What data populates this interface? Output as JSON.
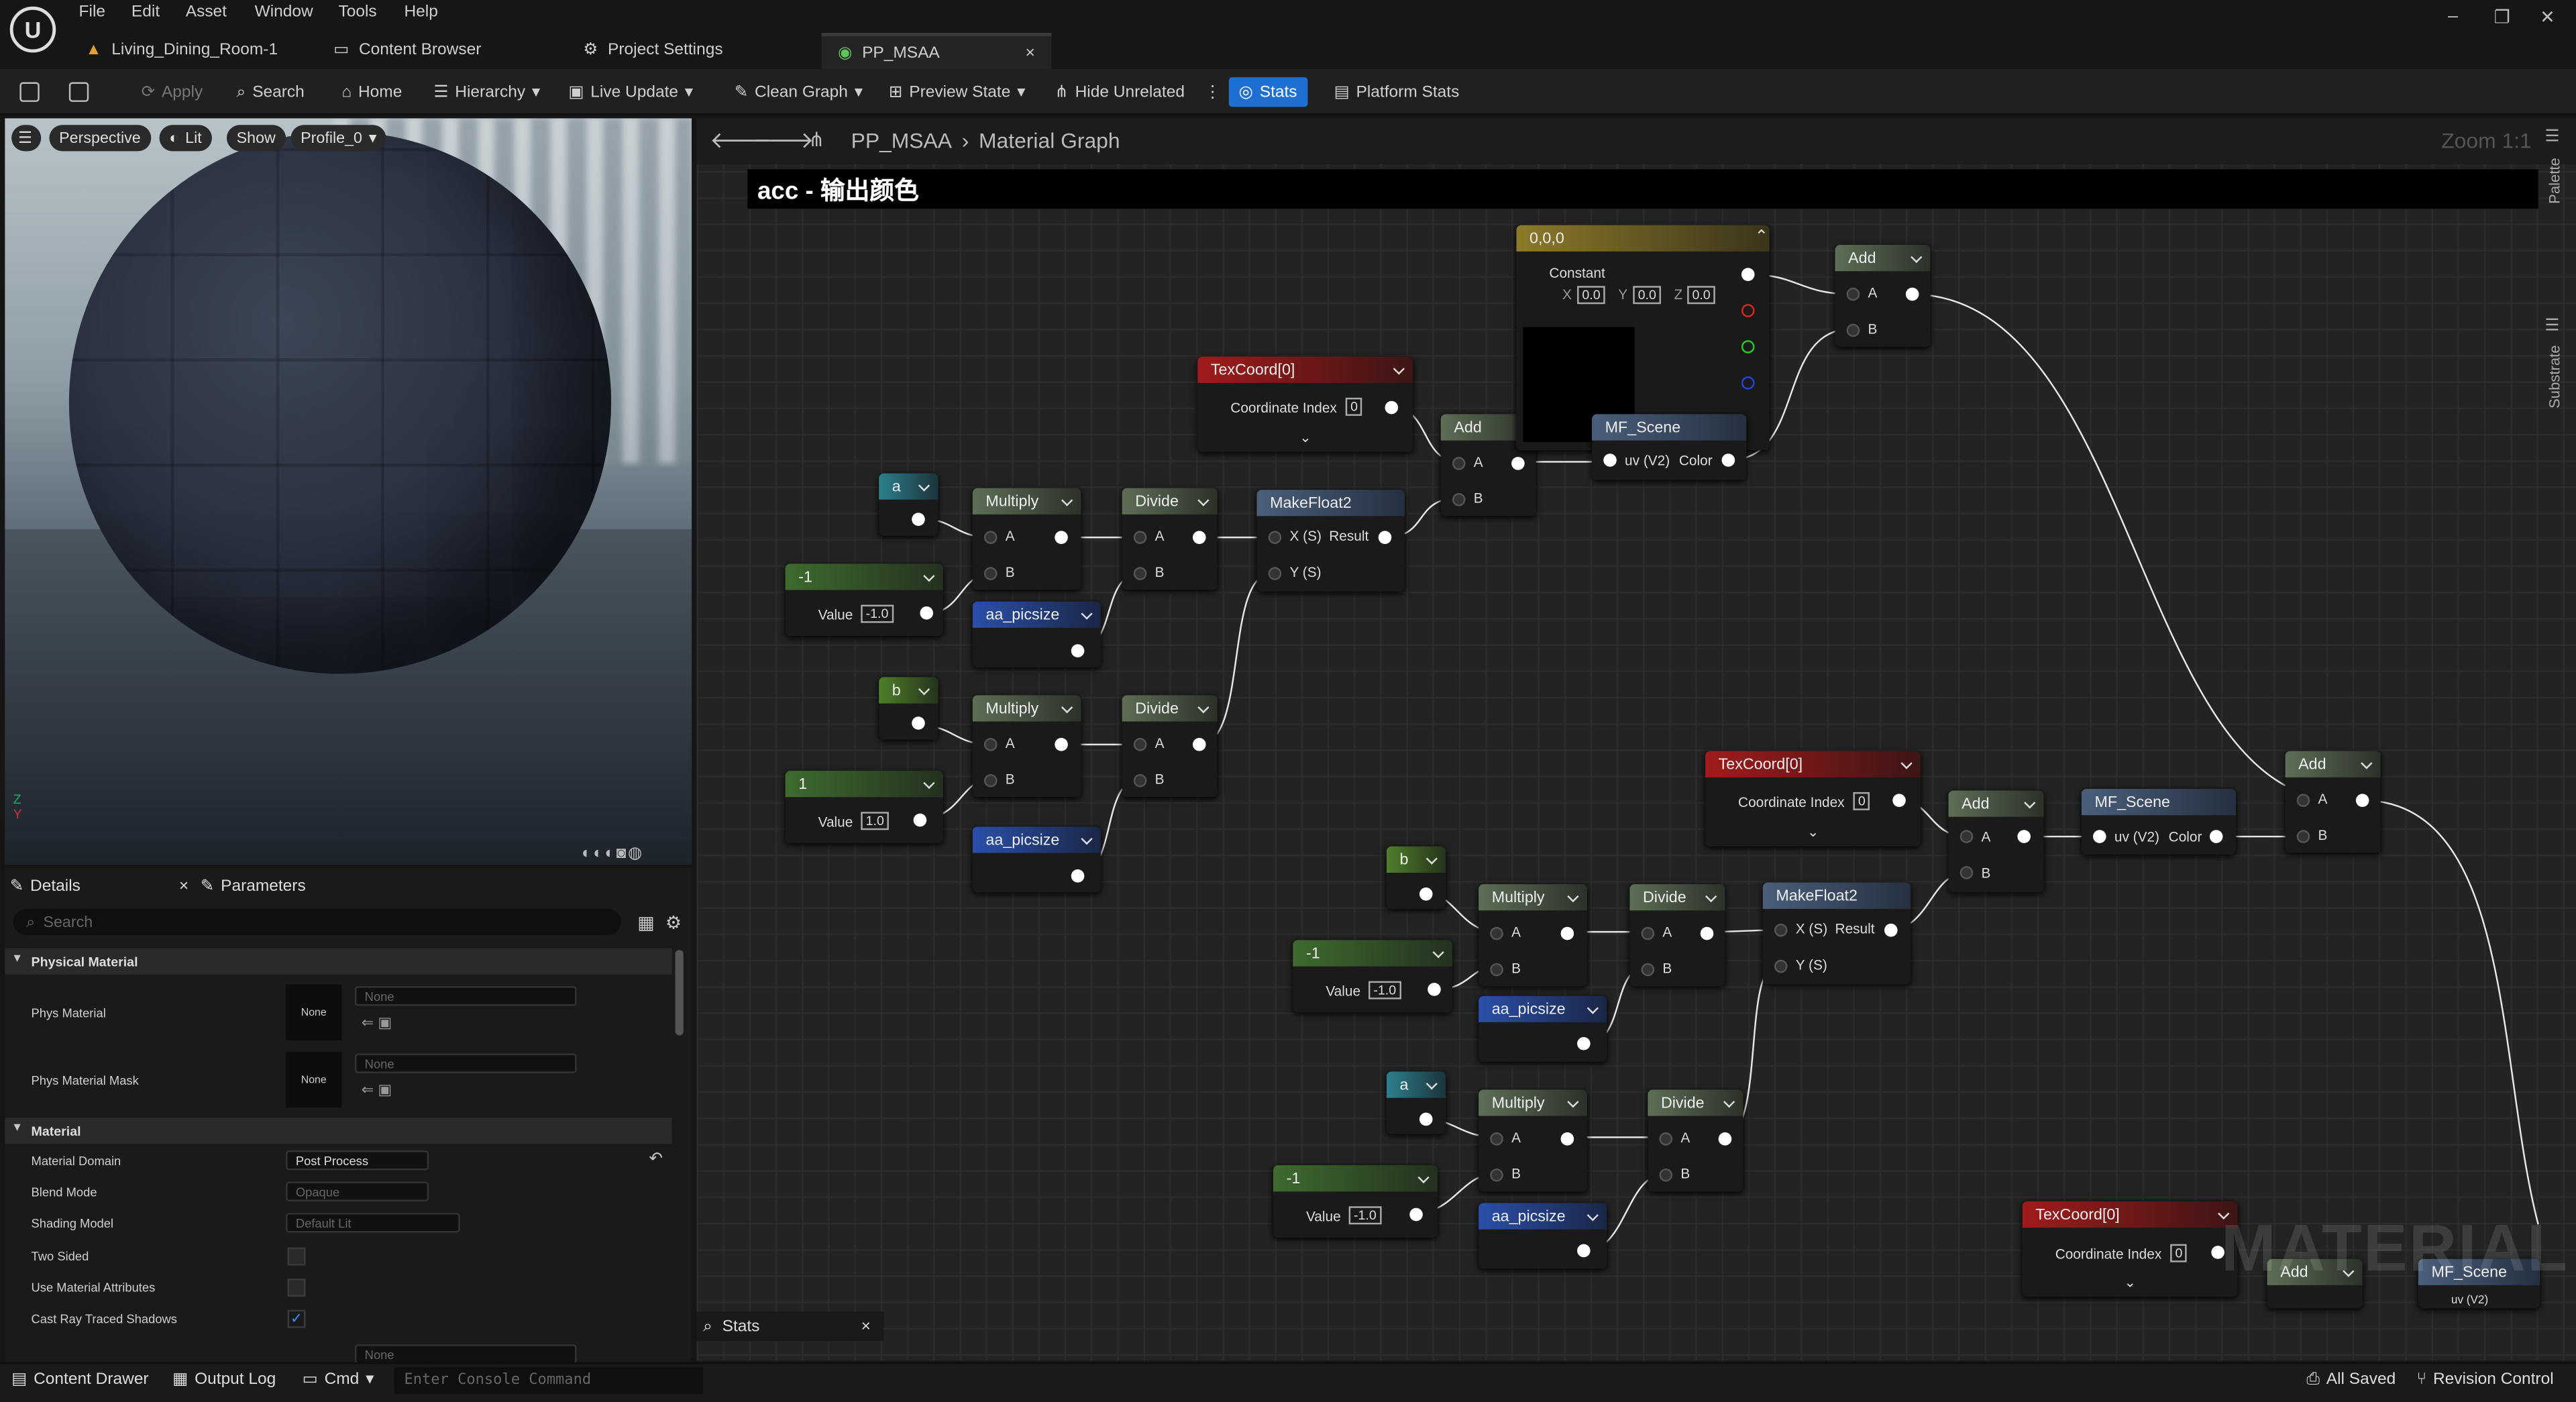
{
  "menu": [
    "File",
    "Edit",
    "Asset",
    "Window",
    "Tools",
    "Help"
  ],
  "tabs": [
    {
      "label": "Living_Dining_Room-1"
    },
    {
      "label": "Content Browser"
    },
    {
      "label": "Project Settings"
    },
    {
      "label": "PP_MSAA"
    }
  ],
  "toolbar": {
    "apply": "Apply",
    "search": "Search",
    "home": "Home",
    "hierarchy": "Hierarchy",
    "live_update": "Live Update",
    "clean_graph": "Clean Graph",
    "preview_state": "Preview State",
    "hide_unrelated": "Hide Unrelated",
    "stats": "Stats",
    "platform_stats": "Platform Stats"
  },
  "viewport": {
    "perspective": "Perspective",
    "lit": "Lit",
    "show": "Show",
    "profile": "Profile_0"
  },
  "details": {
    "tab_details": "Details",
    "tab_parameters": "Parameters",
    "search_placeholder": "Search",
    "section_physical": "Physical Material",
    "section_material": "Material",
    "phys_material": "Phys Material",
    "phys_material_mask": "Phys Material Mask",
    "none": "None",
    "props": [
      {
        "label": "Material Domain",
        "value": "Post Process"
      },
      {
        "label": "Blend Mode",
        "value": "Opaque"
      },
      {
        "label": "Shading Model",
        "value": "Default Lit"
      },
      {
        "label": "Two Sided",
        "value": ""
      },
      {
        "label": "Use Material Attributes",
        "value": ""
      },
      {
        "label": "Cast Ray Traced Shadows",
        "value": "checked"
      }
    ]
  },
  "graph": {
    "breadcrumb_asset": "PP_MSAA",
    "breadcrumb_graph": "Material Graph",
    "zoom": "Zoom 1:1",
    "comment": "acc - 输出颜色",
    "palette": "Palette",
    "substrate": "Substrate",
    "watermark": "MATERIAL",
    "labels": {
      "add": "Add",
      "multiply": "Multiply",
      "divide": "Divide",
      "makefloat2": "MakeFloat2",
      "texcoord": "TexCoord[0]",
      "coord_index": "Coordinate Index",
      "mf_scene": "MF_Scene",
      "aa_picsize": "aa_picsize",
      "constant_title": "0,0,0",
      "constant": "Constant",
      "a": "a",
      "b": "b",
      "value": "Value",
      "neg1": "-1",
      "pos1": "1",
      "pin_a": "A",
      "pin_b": "B",
      "pin_x": "X (S)",
      "pin_y": "Y (S)",
      "pin_result": "Result",
      "pin_uv": "uv (V2)",
      "pin_color": "Color",
      "v_neg1": "-1.0",
      "v_pos1": "1.0",
      "v_zero": "0",
      "v_00": "0.0",
      "cx": "X",
      "cy": "Y",
      "cz": "Z"
    }
  },
  "stats_tab": "Stats",
  "bottom": {
    "content_drawer": "Content Drawer",
    "output_log": "Output Log",
    "cmd": "Cmd",
    "console_placeholder": "Enter Console Command",
    "all_saved": "All Saved",
    "revision_control": "Revision Control"
  }
}
